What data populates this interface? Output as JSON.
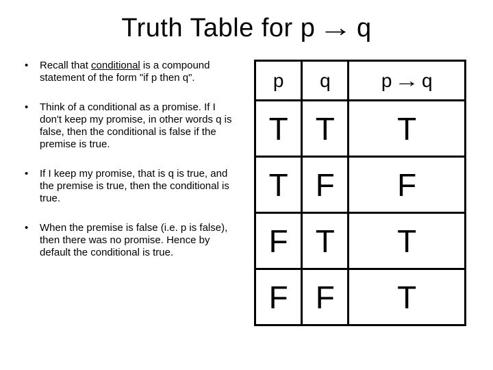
{
  "title_prefix": "Truth Table for p ",
  "title_suffix": " q",
  "arrow": "→",
  "bullets": [
    {
      "pre": "Recall that ",
      "under": "conditional",
      "post": " is a compound statement of the form \"if p then q\"."
    },
    {
      "pre": "",
      "under": "",
      "post": "Think of a conditional as a promise. If I don't keep my promise, in other words q is false, then the conditional is false if the premise is true."
    },
    {
      "pre": "",
      "under": "",
      "post": "If I keep my promise, that is q is true, and the premise is true, then the conditional is true."
    },
    {
      "pre": "",
      "under": "",
      "post": "When the premise is false (i.e. p is false), then there was no promise. Hence by default the conditional is true."
    }
  ],
  "chart_data": {
    "type": "table",
    "title": "Truth Table for p → q",
    "columns": [
      "p",
      "q",
      "p → q"
    ],
    "rows": [
      [
        "T",
        "T",
        "T"
      ],
      [
        "T",
        "F",
        "F"
      ],
      [
        "F",
        "T",
        "T"
      ],
      [
        "F",
        "F",
        "T"
      ]
    ]
  },
  "table_header": {
    "c0": "p",
    "c1": "q",
    "c2_pre": "p ",
    "c2_post": " q"
  }
}
